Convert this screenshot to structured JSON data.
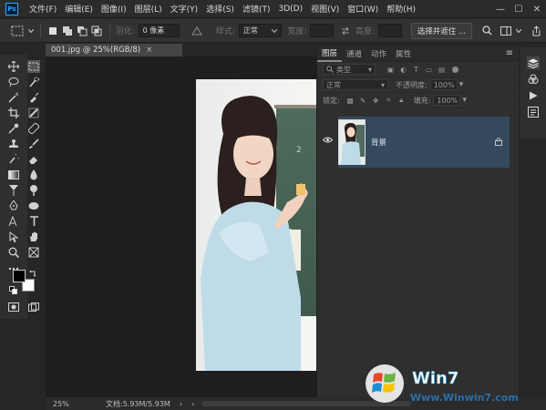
{
  "app": {
    "logo": "Ps"
  },
  "menu": [
    "文件(F)",
    "编辑(E)",
    "图像(I)",
    "图层(L)",
    "文字(Y)",
    "选择(S)",
    "滤镜(T)",
    "3D(D)",
    "视图(V)",
    "窗口(W)",
    "帮助(H)"
  ],
  "window_controls": {
    "minimize": "—",
    "maximize": "☐",
    "close": "✕"
  },
  "options": {
    "feather_label": "羽化:",
    "feather_value": "0 像素",
    "style_label": "样式:",
    "style_value": "正常",
    "width_label": "宽度:",
    "height_label": "高度:",
    "select_mask_button": "选择并遮住 ..."
  },
  "document": {
    "tab_title": "001.jpg @ 25%(RGB/8)",
    "tab_close": "×"
  },
  "status": {
    "zoom": "25%",
    "doc_size": "文档:5.93M/5.93M"
  },
  "layers_panel": {
    "tabs": [
      "图层",
      "通道",
      "动作",
      "属性"
    ],
    "menu_icon": "≡",
    "filter_kind": "类型",
    "blend_mode": "正常",
    "opacity_label": "不透明度:",
    "opacity_value": "100%",
    "lock_label": "锁定:",
    "fill_label": "填充:",
    "fill_value": "100%",
    "layer_name": "背景"
  },
  "watermark": {
    "brand": "Win7",
    "url": "Www.Winwin7.com"
  },
  "colors": {
    "accent": "#31a8ff",
    "selected_layer": "#34495e",
    "panel_bg": "#2f2f2f",
    "canvas_bg": "#1e1e1e"
  }
}
